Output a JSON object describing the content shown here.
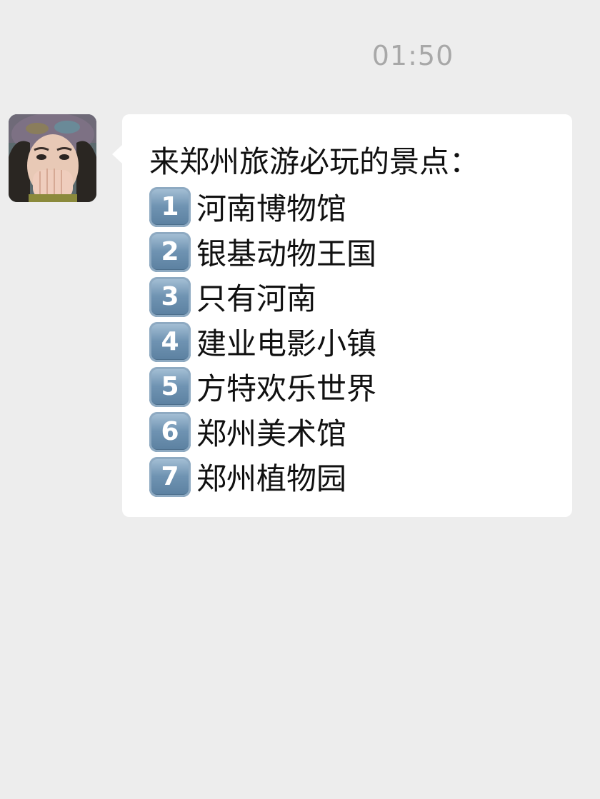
{
  "chat": {
    "timestamp": "01:50",
    "message": {
      "heading": "来郑州旅游必玩的景点：",
      "items": [
        {
          "number": "1",
          "text": "河南博物馆"
        },
        {
          "number": "2",
          "text": "银基动物王国"
        },
        {
          "number": "3",
          "text": "只有河南"
        },
        {
          "number": "4",
          "text": "建业电影小镇"
        },
        {
          "number": "5",
          "text": "方特欢乐世界"
        },
        {
          "number": "6",
          "text": "郑州美术馆"
        },
        {
          "number": "7",
          "text": "郑州植物园"
        }
      ]
    }
  }
}
